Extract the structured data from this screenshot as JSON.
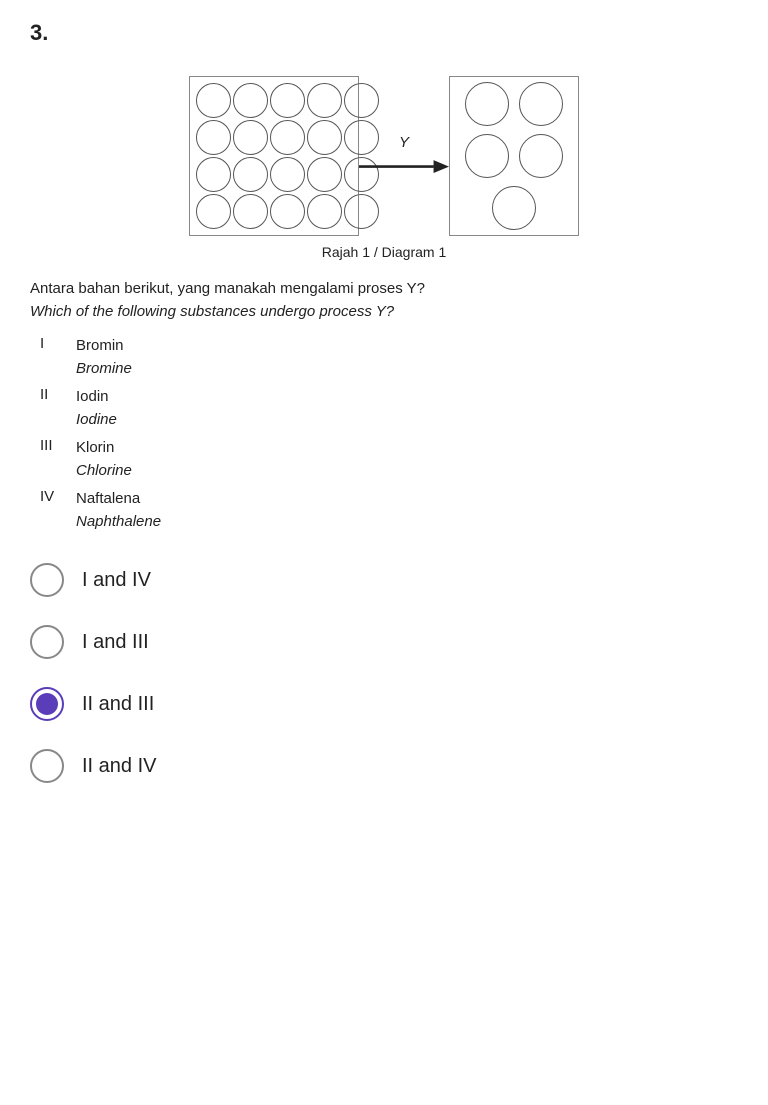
{
  "question": {
    "number": "3.",
    "page_number": "1",
    "diagram_label_y": "Y",
    "caption": "Rajah 1 / Diagram 1",
    "question_text_ms": "Antara bahan berikut, yang manakah mengalami proses Y?",
    "question_text_en": "Which of the following substances undergo process Y?",
    "substances": [
      {
        "numeral": "I",
        "ms": "Bromin",
        "en": "Bromine"
      },
      {
        "numeral": "II",
        "ms": "Iodin",
        "en": "Iodine"
      },
      {
        "numeral": "III",
        "ms": "Klorin",
        "en": "Chlorine"
      },
      {
        "numeral": "IV",
        "ms": "Naftalena",
        "en": "Naphthalene"
      }
    ],
    "choices": [
      {
        "id": "A",
        "label": "I and IV",
        "selected": false
      },
      {
        "id": "B",
        "label": "I and III",
        "selected": false
      },
      {
        "id": "C",
        "label": "II and III",
        "selected": true
      },
      {
        "id": "D",
        "label": "II and IV",
        "selected": false
      }
    ]
  }
}
